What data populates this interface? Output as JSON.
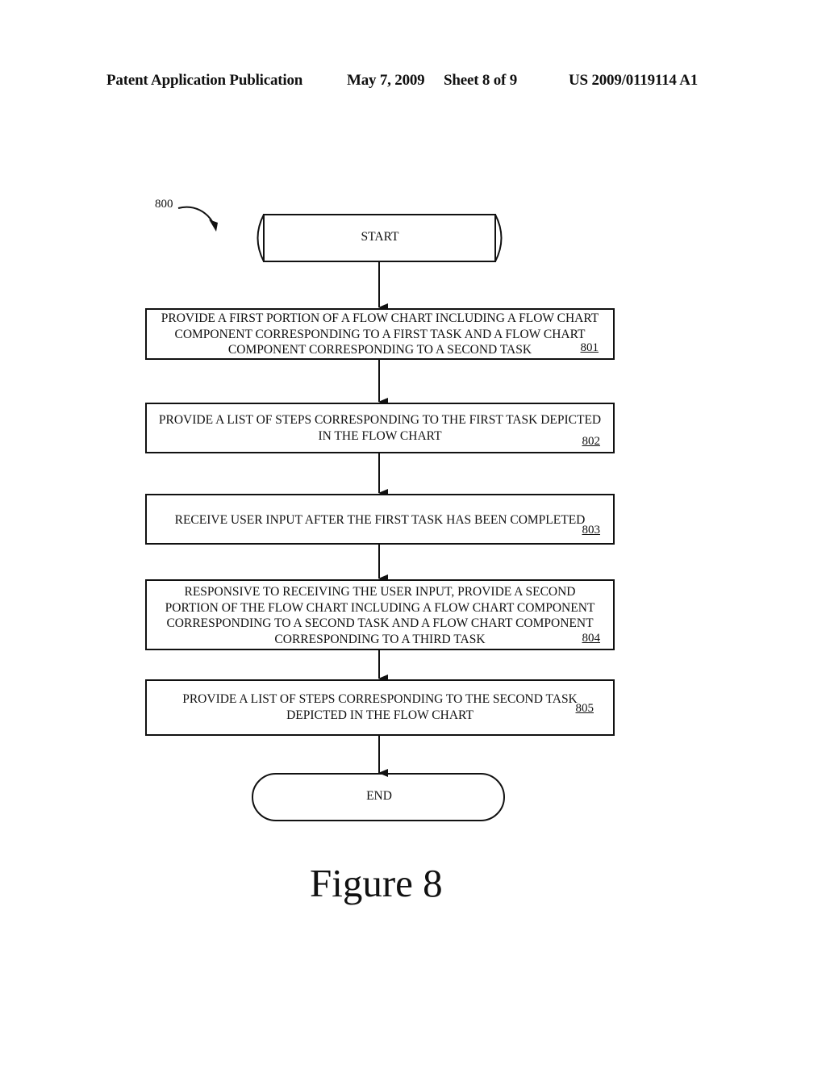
{
  "header": {
    "publication": "Patent Application Publication",
    "date": "May 7, 2009",
    "sheet": "Sheet 8 of 9",
    "number": "US 2009/0119114 A1"
  },
  "figure": {
    "reference": "800",
    "caption": "Figure 8",
    "start_label": "START",
    "end_label": "END",
    "steps": [
      {
        "ref": "801",
        "lines": [
          "PROVIDE A FIRST PORTION OF A FLOW CHART INCLUDING A FLOW CHART",
          "COMPONENT CORRESPONDING TO A FIRST TASK AND A FLOW CHART",
          "COMPONENT CORRESPONDING TO A SECOND TASK"
        ]
      },
      {
        "ref": "802",
        "lines": [
          "PROVIDE A LIST OF STEPS CORRESPONDING TO THE FIRST TASK DEPICTED",
          "IN THE FLOW CHART"
        ]
      },
      {
        "ref": "803",
        "lines": [
          "RECEIVE USER INPUT AFTER THE FIRST TASK HAS BEEN COMPLETED"
        ]
      },
      {
        "ref": "804",
        "lines": [
          "RESPONSIVE TO RECEIVING THE USER INPUT, PROVIDE A SECOND",
          "PORTION OF THE FLOW CHART INCLUDING A FLOW CHART COMPONENT",
          "CORRESPONDING TO A SECOND TASK AND A FLOW CHART COMPONENT",
          "CORRESPONDING TO A THIRD TASK"
        ]
      },
      {
        "ref": "805",
        "lines": [
          "PROVIDE A LIST OF STEPS CORRESPONDING TO THE SECOND TASK",
          "DEPICTED IN THE FLOW CHART"
        ]
      }
    ]
  }
}
